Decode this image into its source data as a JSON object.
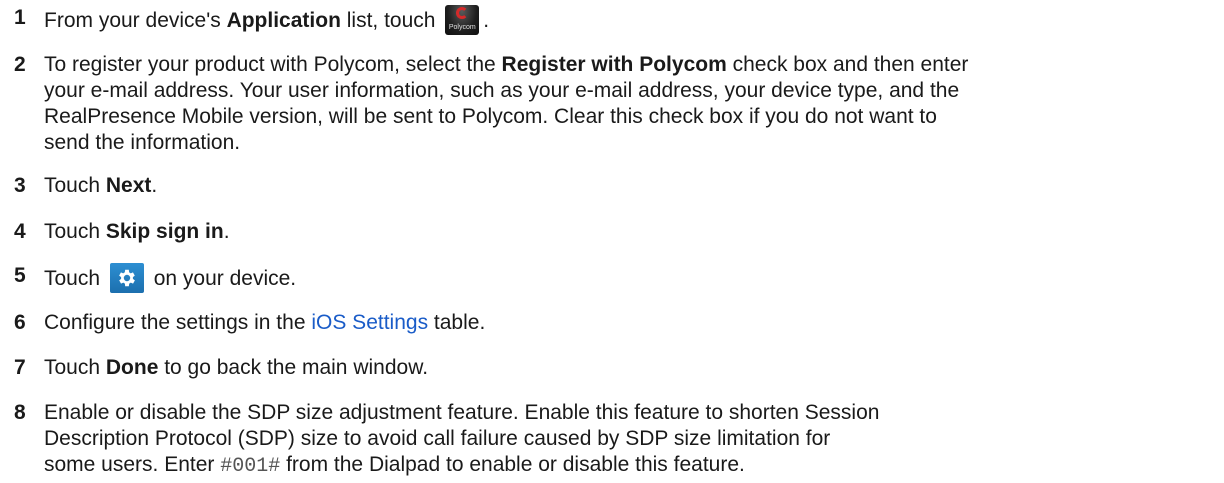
{
  "steps": [
    {
      "num": "1",
      "pre": "From your device's ",
      "bold": "Application",
      "mid": " list, touch ",
      "icon": "polycom-app-icon",
      "icon_text": "Polycom",
      "post": "."
    },
    {
      "num": "2",
      "pre": "To register your product with Polycom, select the ",
      "bold": "Register with Polycom",
      "post_line1": " check box and then enter",
      "line2": "your e-mail address. Your user information, such as your e-mail address, your device type, and the",
      "line3": "RealPresence Mobile version, will be sent to Polycom. Clear this check box if you do not want to",
      "line4": "send the information."
    },
    {
      "num": "3",
      "pre": "Touch ",
      "bold": "Next",
      "post": "."
    },
    {
      "num": "4",
      "pre": "Touch ",
      "bold": "Skip sign in",
      "post": "."
    },
    {
      "num": "5",
      "pre": "Touch ",
      "icon": "settings-gear-icon",
      "post": " on your device."
    },
    {
      "num": "6",
      "pre": "Configure the settings in the ",
      "link": "iOS Settings",
      "post": " table."
    },
    {
      "num": "7",
      "pre": "Touch ",
      "bold": "Done",
      "post": " to go back the main window."
    },
    {
      "num": "8",
      "line1": "Enable or disable the SDP size adjustment feature. Enable this feature to shorten Session",
      "line2": "Description Protocol (SDP) size to avoid call failure caused by SDP size limitation for",
      "line3_pre": "some users. Enter ",
      "code": "#001#",
      "line3_post": " from the Dialpad to enable or disable this feature."
    }
  ],
  "colors": {
    "link": "#1a5cc8",
    "gear_bg": "#2d8fd2",
    "polycom_red": "#d42a2a"
  }
}
